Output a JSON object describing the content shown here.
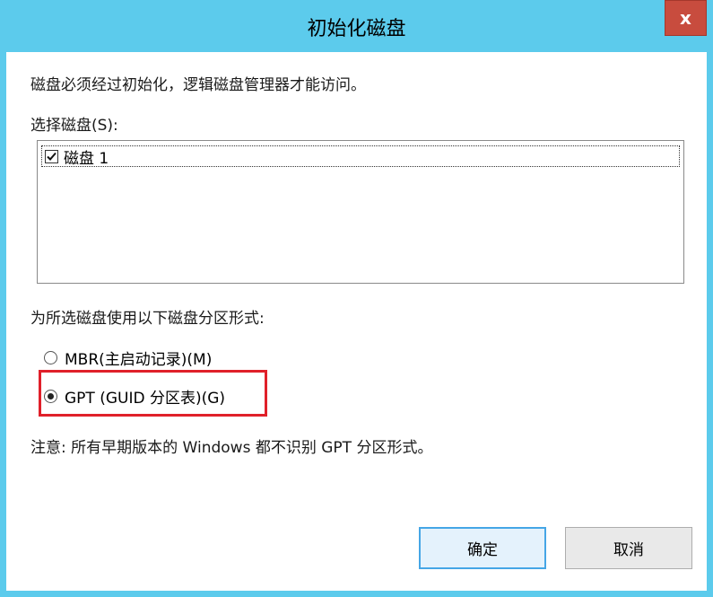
{
  "window": {
    "title": "初始化磁盘",
    "close_label": "x"
  },
  "dialog": {
    "description": "磁盘必须经过初始化，逻辑磁盘管理器才能访问。",
    "select_label": "选择磁盘(S):",
    "disks": [
      {
        "label": "磁盘 1",
        "checked": true
      }
    ],
    "partition_label": "为所选磁盘使用以下磁盘分区形式:",
    "partition_options": [
      {
        "label": "MBR(主启动记录)(M)",
        "selected": false
      },
      {
        "label": "GPT (GUID 分区表)(G)",
        "selected": true
      }
    ],
    "note": "注意: 所有早期版本的 Windows 都不识别 GPT 分区形式。",
    "ok_label": "确定",
    "cancel_label": "取消"
  },
  "colors": {
    "titlebar": "#5ccbec",
    "close_button": "#c84c3e",
    "highlight": "#e0202a",
    "default_button_border": "#45a6e6"
  }
}
